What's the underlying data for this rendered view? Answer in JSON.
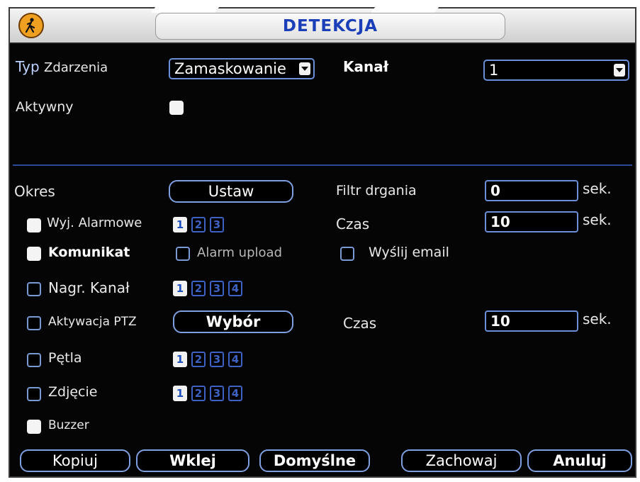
{
  "title": "DETEKCJA",
  "event_type": {
    "label_prefix": "Typ",
    "label_suffix": "Zdarzenia",
    "value": "Zamaskowanie"
  },
  "channel": {
    "label": "Kanał",
    "value": "1"
  },
  "active": {
    "label": "Aktywny",
    "checked": true
  },
  "period": {
    "label": "Okres",
    "button": "Ustaw"
  },
  "debounce": {
    "label": "Filtr drgania",
    "value": "0",
    "unit": "sek."
  },
  "alarm_out": {
    "label": "Wyj. Alarmowe",
    "checked": true,
    "channels": [
      "1",
      "2",
      "3"
    ]
  },
  "alarm_out_time": {
    "label": "Czas",
    "value": "10",
    "unit": "sek."
  },
  "message": {
    "label": "Komunikat",
    "checked": true
  },
  "alarm_upload": {
    "label": "Alarm upload",
    "checked": false
  },
  "send_email": {
    "label": "Wyślij email",
    "checked": false
  },
  "record_channel": {
    "label": "Nagr. Kanał",
    "checked": false,
    "channels": [
      "1",
      "2",
      "3",
      "4"
    ]
  },
  "ptz": {
    "label": "Aktywacja PTZ",
    "checked": false,
    "button": "Wybór"
  },
  "ptz_time": {
    "label": "Czas",
    "value": "10",
    "unit": "sek."
  },
  "tour": {
    "label": "Pętla",
    "checked": false,
    "channels": [
      "1",
      "2",
      "3",
      "4"
    ]
  },
  "snapshot": {
    "label": "Zdjęcie",
    "checked": false,
    "channels": [
      "1",
      "2",
      "3",
      "4"
    ]
  },
  "buzzer": {
    "label": "Buzzer",
    "checked": true
  },
  "buttons": {
    "copy": "Kopiuj",
    "paste": "Wklej",
    "default": "Domyślne",
    "save": "Zachowaj",
    "cancel": "Anuluj"
  },
  "colors": {
    "title_text": "#1a3fb8",
    "border_blue": "#6a8fd8",
    "background": "#050505"
  }
}
